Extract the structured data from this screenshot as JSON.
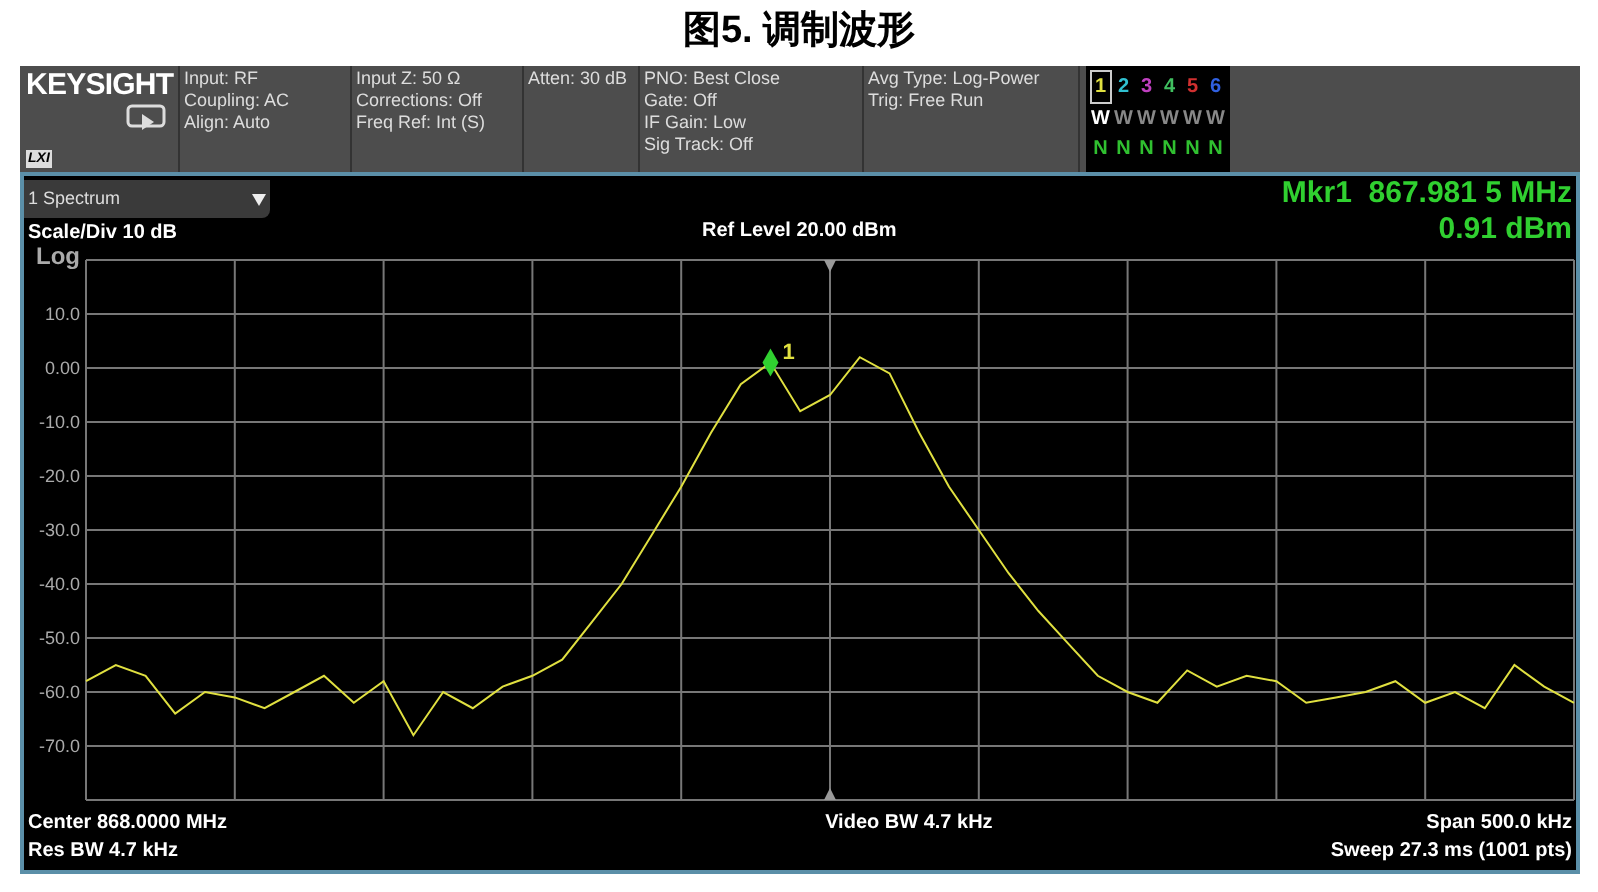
{
  "caption": "图5. 调制波形",
  "header": {
    "logo": "KEYSIGHT",
    "badge": "LXI",
    "groups": [
      [
        "Input: RF",
        "Coupling: AC",
        "Align: Auto"
      ],
      [
        "Input Z: 50 Ω",
        "Corrections: Off",
        "Freq Ref: Int (S)"
      ],
      [
        "Atten: 30 dB"
      ],
      [
        "PNO: Best Close",
        "Gate: Off",
        "IF Gain: Low",
        "Sig Track: Off"
      ],
      [
        "Avg Type: Log-Power",
        "Trig: Free Run"
      ]
    ],
    "traces": [
      {
        "number": "1",
        "color": "#e0e040",
        "selected": true,
        "mode": "W",
        "mode_active": true,
        "detector": "N"
      },
      {
        "number": "2",
        "color": "#30c0d0",
        "selected": false,
        "mode": "W",
        "mode_active": false,
        "detector": "N"
      },
      {
        "number": "3",
        "color": "#c040c0",
        "selected": false,
        "mode": "W",
        "mode_active": false,
        "detector": "N"
      },
      {
        "number": "4",
        "color": "#40c060",
        "selected": false,
        "mode": "W",
        "mode_active": false,
        "detector": "N"
      },
      {
        "number": "5",
        "color": "#d03030",
        "selected": false,
        "mode": "W",
        "mode_active": false,
        "detector": "N"
      },
      {
        "number": "6",
        "color": "#3060e0",
        "selected": false,
        "mode": "W",
        "mode_active": false,
        "detector": "N"
      }
    ]
  },
  "window_selector": "1 Spectrum",
  "marker": {
    "frequency": "Mkr1  867.981 5 MHz",
    "amplitude": "0.91 dBm",
    "label": "1"
  },
  "scale": "Scale/Div 10 dB",
  "ref_level": "Ref Level 20.00 dBm",
  "scale_type": "Log",
  "chart_data": {
    "type": "line",
    "ylim": [
      -80,
      20
    ],
    "grid": true,
    "yticks": [
      {
        "value": 10,
        "label": "10.0"
      },
      {
        "value": 0,
        "label": "0.00"
      },
      {
        "value": -10,
        "label": "-10.0"
      },
      {
        "value": -20,
        "label": "-20.0"
      },
      {
        "value": -30,
        "label": "-30.0"
      },
      {
        "value": -40,
        "label": "-40.0"
      },
      {
        "value": -50,
        "label": "-50.0"
      },
      {
        "value": -60,
        "label": "-60.0"
      },
      {
        "value": -70,
        "label": "-70.0"
      }
    ],
    "categories": [
      null,
      null,
      null,
      null,
      null,
      null,
      null,
      null,
      null,
      null,
      null,
      null,
      null,
      null,
      null,
      null,
      null,
      null,
      null,
      null,
      null,
      null,
      null,
      null,
      null,
      null,
      null,
      null,
      null,
      null,
      null,
      null,
      null,
      null,
      null,
      null,
      null,
      null,
      null,
      null,
      null,
      null,
      null,
      null,
      null,
      null,
      null,
      null,
      null,
      null,
      null
    ],
    "series": [
      {
        "color": "#e0e040",
        "values": [
          -58,
          -55,
          -57,
          -64,
          -60,
          -61,
          -63,
          -60,
          -57,
          -62,
          -58,
          -68,
          -60,
          -63,
          -59,
          -57,
          -54,
          -47,
          -40,
          -31,
          -22,
          -12,
          -3,
          1,
          -8,
          -5,
          2,
          -1,
          -12,
          -22,
          -30,
          -38,
          -45,
          -51,
          -57,
          -60,
          -62,
          -56,
          -59,
          -57,
          -58,
          -62,
          -61,
          -60,
          -58,
          -62,
          -60,
          -63,
          -55,
          -59,
          -62
        ]
      }
    ]
  },
  "footer": {
    "center": "Center 868.0000 MHz",
    "video_bw": "Video BW 4.7 kHz",
    "span": "Span 500.0 kHz",
    "res_bw": "Res BW 4.7 kHz",
    "sweep": "Sweep 27.3 ms (1001 pts)"
  }
}
